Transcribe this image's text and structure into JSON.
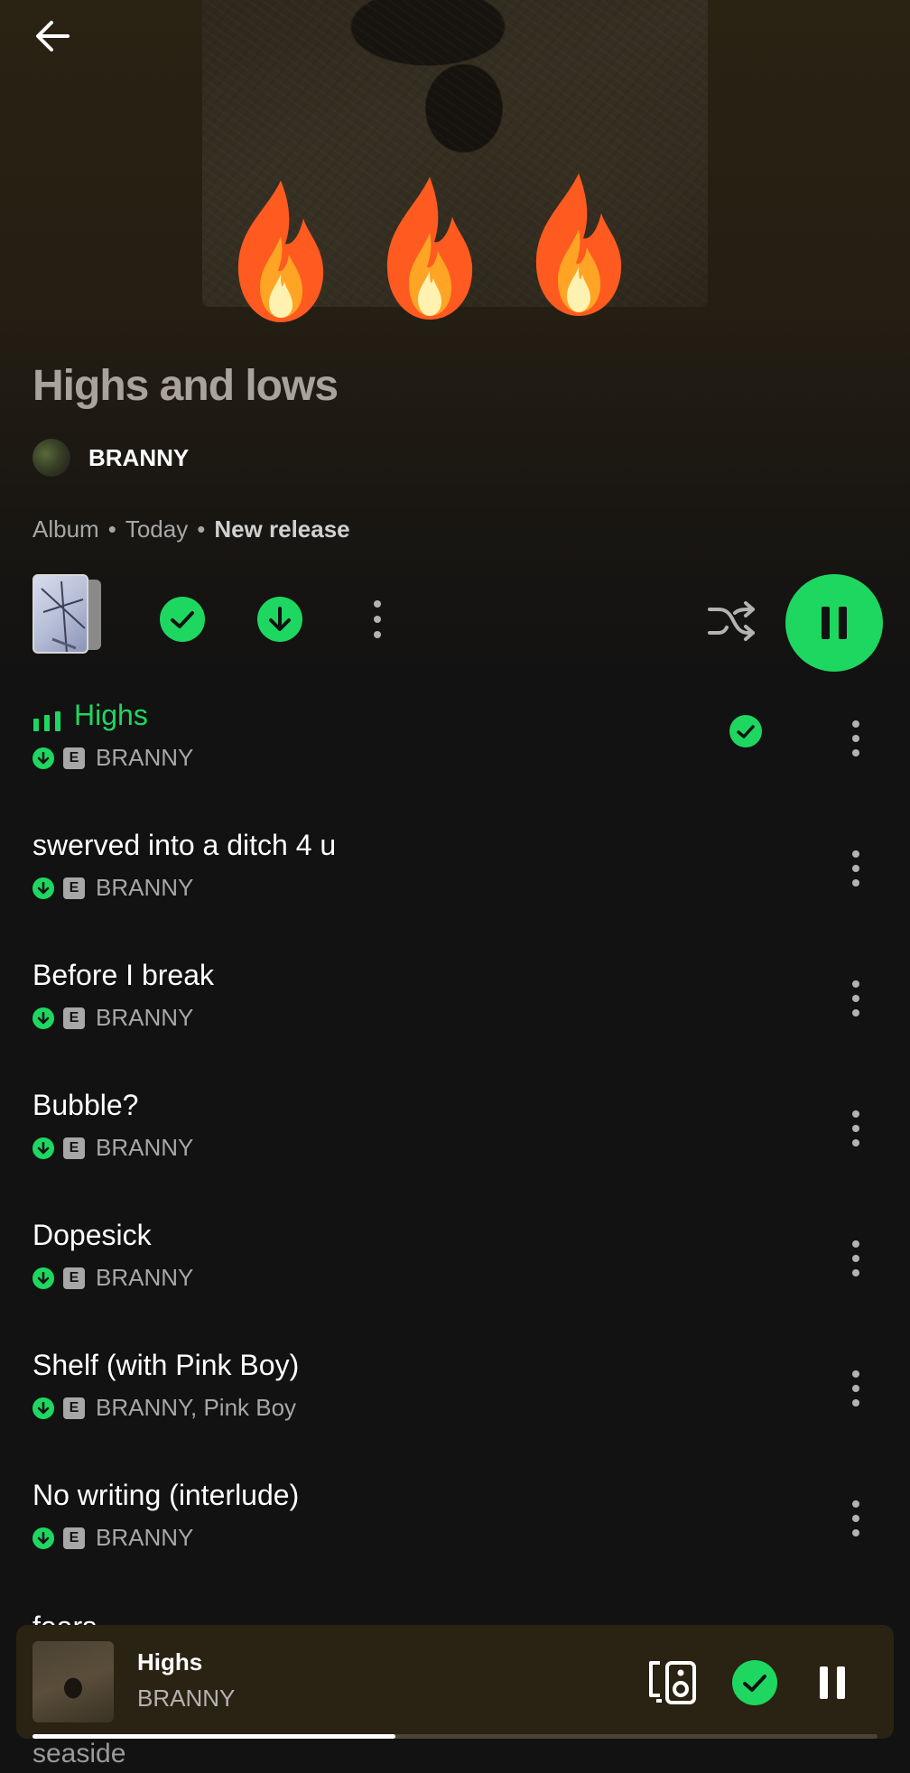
{
  "album": {
    "title": "Highs and lows",
    "artist": "BRANNY",
    "type": "Album",
    "date": "Today",
    "tag": "New release",
    "dot": "•"
  },
  "controls": {
    "saved_icon": "check-circle-icon",
    "downloaded_icon": "download-icon",
    "more_icon": "more-vertical-icon",
    "shuffle_icon": "shuffle-icon",
    "play_state": "pause"
  },
  "tracks": [
    {
      "title": "Highs",
      "artists": "BRANNY",
      "explicit": "E",
      "active": true,
      "saved": true
    },
    {
      "title": "swerved into a ditch 4 u",
      "artists": "BRANNY",
      "explicit": "E"
    },
    {
      "title": "Before I break",
      "artists": "BRANNY",
      "explicit": "E"
    },
    {
      "title": "Bubble?",
      "artists": "BRANNY",
      "explicit": "E"
    },
    {
      "title": "Dopesick",
      "artists": "BRANNY",
      "explicit": "E"
    },
    {
      "title": "Shelf (with Pink Boy)",
      "artists": "BRANNY, Pink Boy",
      "explicit": "E"
    },
    {
      "title": "No writing (interlude)",
      "artists": "BRANNY",
      "explicit": "E"
    }
  ],
  "partial_track": "fears",
  "partial_bottom": "seaside",
  "now_playing": {
    "title": "Highs",
    "artist": "BRANNY",
    "progress": 0.43
  },
  "colors": {
    "accent": "#1ed760",
    "background": "#121212",
    "miniplayer": "#2a2212"
  }
}
